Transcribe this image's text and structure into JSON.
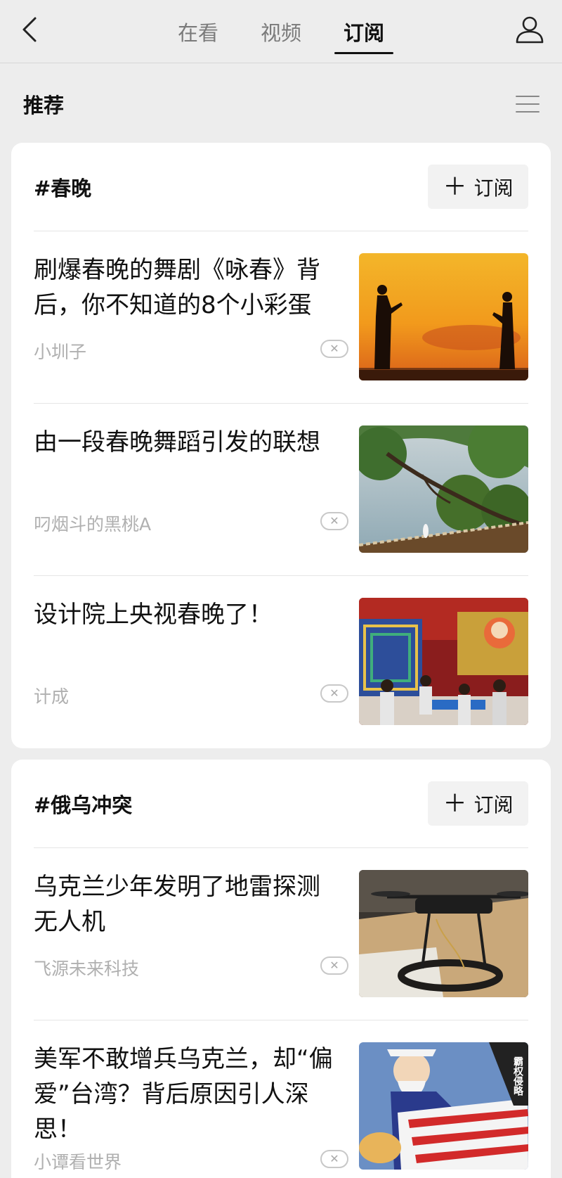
{
  "nav": {
    "tabs": [
      {
        "label": "在看",
        "active": false
      },
      {
        "label": "视频",
        "active": false
      },
      {
        "label": "订阅",
        "active": true
      }
    ],
    "back_icon": "back-chevron-icon",
    "profile_icon": "person-icon"
  },
  "section": {
    "title": "推荐",
    "menu_icon": "menu-icon"
  },
  "topics": [
    {
      "tag": "#春晚",
      "subscribe_label": "订阅",
      "articles": [
        {
          "title": "刷爆春晚的舞剧《咏春》背后，你不知道的8个小彩蛋",
          "author": "小圳子",
          "image": "dance-silhouette-image"
        },
        {
          "title": "由一段春晚舞蹈引发的联想",
          "author": "叼烟斗的黑桃A",
          "image": "riverside-tree-image"
        },
        {
          "title": "设计院上央视春晚了！",
          "author": "计成",
          "image": "gala-stage-image"
        }
      ]
    },
    {
      "tag": "#俄乌冲突",
      "subscribe_label": "订阅",
      "articles": [
        {
          "title": "乌克兰少年发明了地雷探测无人机",
          "author": "飞源未来科技",
          "image": "drone-image"
        },
        {
          "title": "美军不敢增兵乌克兰，却“偏爱”台湾？背后原因引人深思！",
          "author": "小谭看世界",
          "image": "uncle-sam-cartoon-image",
          "cartoon_text": "霸权侵略"
        }
      ]
    }
  ],
  "colors": {
    "background": "#ededed",
    "card": "#ffffff",
    "meta_text": "#b0b0b0"
  }
}
